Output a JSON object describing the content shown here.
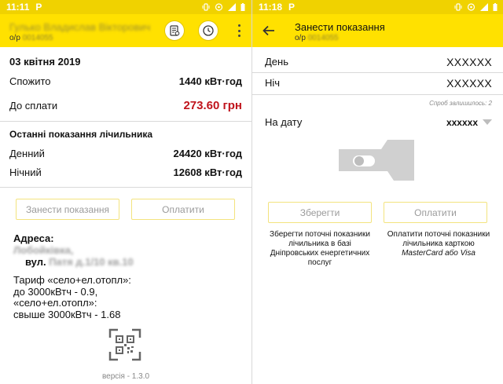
{
  "left": {
    "statusbar": {
      "time": "11:11",
      "app_letter": "P"
    },
    "header": {
      "user_name": "Гулько Владислав Вікторович",
      "account_prefix": "о/р",
      "account_number": "0014055"
    },
    "date": "03 квітня 2019",
    "consumed": {
      "label": "Спожито",
      "value": "1440 кВт·год"
    },
    "to_pay": {
      "label": "До сплати",
      "value": "273.60 грн",
      "color": "#c0141c"
    },
    "meter_section_title": "Останні показання лічильника",
    "day": {
      "label": "Денний",
      "value": "24420 кВт·год"
    },
    "night": {
      "label": "Нічний",
      "value": "12608 кВт·год"
    },
    "buttons": {
      "enter_readings": "Занести показання",
      "pay": "Оплатити"
    },
    "address": {
      "label": "Адреса:",
      "city": "Лобойківка,",
      "street_prefix": "вул.",
      "street_rest": "Патя д.1/10 кв.10"
    },
    "tariff_lines": [
      "Тариф «село+ел.отопл»:",
      " до 3000кВтч - 0.9,",
      " «село+ел.отопл»:",
      " свыше 3000кВтч - 1.68"
    ],
    "version": "версія - 1.3.0",
    "icons": [
      "receipt-icon",
      "clock-icon",
      "more-vert-icon",
      "qr-code-icon"
    ]
  },
  "right": {
    "statusbar": {
      "time": "11:18",
      "app_letter": "P"
    },
    "header": {
      "title": "Занести показання",
      "account_prefix": "о/р",
      "account_number": "0014055"
    },
    "day": {
      "label": "День",
      "value": "XXXXXX"
    },
    "night": {
      "label": "Ніч",
      "value": "XXXXXX"
    },
    "attempts_hint": "Спроб залишилось: 2",
    "on_date": {
      "label": "На дату",
      "value": "xxxxxx"
    },
    "buttons": {
      "save": "Зберегти",
      "pay": "Оплатити"
    },
    "save_desc": [
      "Зберегти поточні показники",
      "лічильника в базі",
      "Дніпровських енергетичних",
      "послуг"
    ],
    "pay_desc": [
      "Оплатити поточні показники",
      "лічильника карткою",
      "MasterCard або Visa"
    ],
    "icons": [
      "back-arrow-icon",
      "dropdown-arrow-icon",
      "toggle-switch-icon"
    ]
  },
  "colors": {
    "appbar": "#ffe100",
    "statusbar": "#f0d200",
    "button_border": "#f3e37e",
    "amount_red": "#c0141c"
  }
}
